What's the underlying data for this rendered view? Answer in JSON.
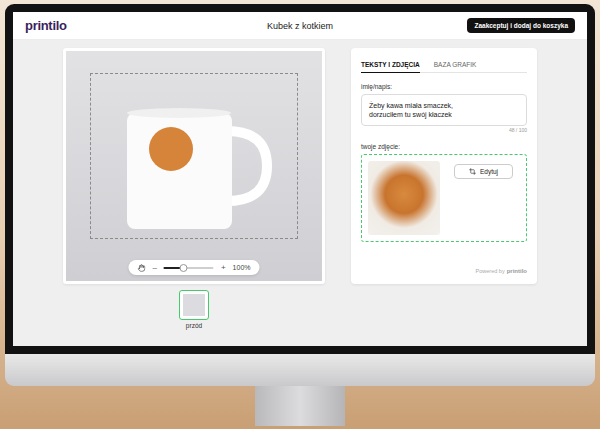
{
  "app": {
    "logo": "printilo",
    "title": "Kubek z kotkiem",
    "accept_button": "Zaakceptuj i dodaj do koszyka"
  },
  "preview": {
    "zoom": {
      "minus": "–",
      "plus": "+",
      "level": 0.4,
      "reading": "100%"
    }
  },
  "views": [
    {
      "label": "przód",
      "selected": true
    }
  ],
  "tabs": [
    {
      "label": "TEKSTY I ZDJĘCIA",
      "selected": true
    },
    {
      "label": "BAZA GRAFIK",
      "selected": false
    }
  ],
  "text_field": {
    "label": "imię/napis:",
    "value": "Żeby kawa miała smaczek,\ndorzuciłem tu swój kłaczek",
    "counter": "48 / 100"
  },
  "photo_field": {
    "label": "twoje zdjęcie:",
    "edit_button": "Edytuj"
  },
  "footer": {
    "powered_by": "Powered by",
    "brand": "printilo"
  }
}
